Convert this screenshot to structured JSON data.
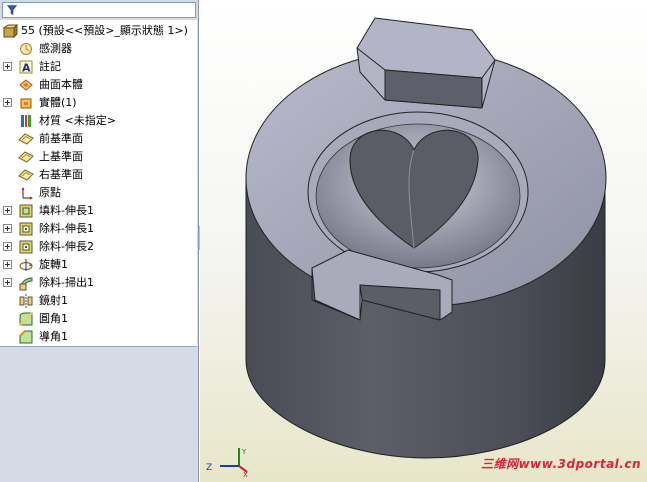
{
  "tree": {
    "root": {
      "label": "55  (預設<<預設>_顯示狀態 1>)",
      "icon": "part-icon"
    },
    "items": [
      {
        "label": "感測器",
        "icon": "sensor-icon",
        "expandable": false
      },
      {
        "label": "註記",
        "icon": "annotation-icon",
        "expandable": true
      },
      {
        "label": "曲面本體",
        "icon": "surface-bodies-icon",
        "expandable": false
      },
      {
        "label": "實體(1)",
        "icon": "solid-bodies-icon",
        "expandable": true
      },
      {
        "label": "材質 <未指定>",
        "icon": "material-icon",
        "expandable": false
      },
      {
        "label": "前基準面",
        "icon": "plane-icon",
        "expandable": false
      },
      {
        "label": "上基準面",
        "icon": "plane-icon",
        "expandable": false
      },
      {
        "label": "右基準面",
        "icon": "plane-icon",
        "expandable": false
      },
      {
        "label": "原點",
        "icon": "origin-icon",
        "expandable": false
      },
      {
        "label": "填料-伸長1",
        "icon": "extrude-boss-icon",
        "expandable": true
      },
      {
        "label": "除料-伸長1",
        "icon": "extrude-cut-icon",
        "expandable": true
      },
      {
        "label": "除料-伸長2",
        "icon": "extrude-cut-icon",
        "expandable": true
      },
      {
        "label": "旋轉1",
        "icon": "revolve-icon",
        "expandable": true
      },
      {
        "label": "除料-掃出1",
        "icon": "sweep-cut-icon",
        "expandable": true
      },
      {
        "label": "鏡射1",
        "icon": "mirror-icon",
        "expandable": false
      },
      {
        "label": "圓角1",
        "icon": "fillet-icon",
        "expandable": false
      },
      {
        "label": "導角1",
        "icon": "chamfer-icon",
        "expandable": false
      }
    ]
  },
  "triad": {
    "z": "Z",
    "x": "X",
    "y": "Y"
  },
  "watermark": "三维网www.3dportal.cn",
  "colors": {
    "panel_bg": "#d4dbe6",
    "model_face": "#9c9eb2",
    "model_side": "#55575f",
    "watermark": "#e0223a"
  }
}
